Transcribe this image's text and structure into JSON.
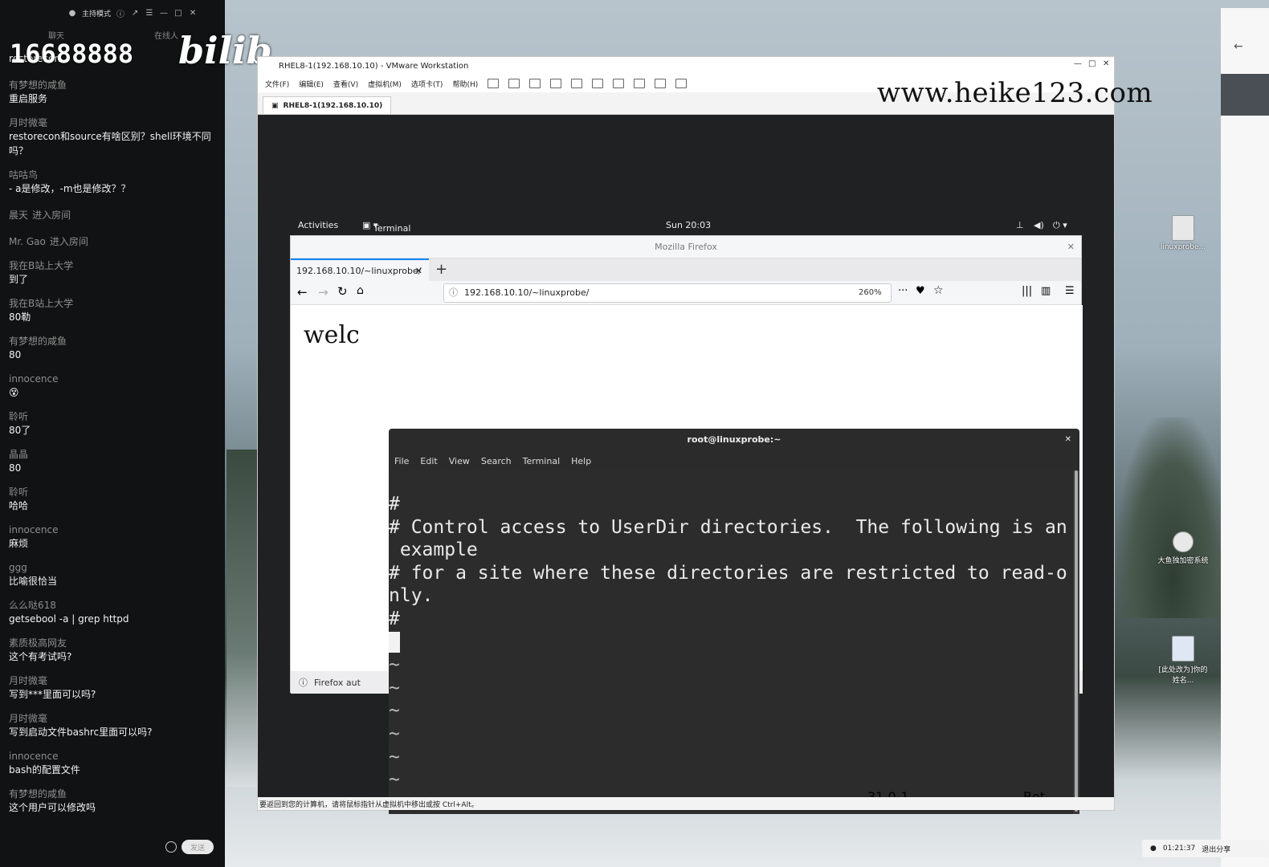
{
  "chat": {
    "topbar_mode": "主持模式",
    "tab_left": "聊天",
    "tab_right": "在线人",
    "overlay_number": "16688888",
    "overlay_logo": "bilibili",
    "first_message": "restorecon",
    "messages": [
      {
        "user": "有梦想的咸鱼",
        "text": "重启服务"
      },
      {
        "user": "月时微毫",
        "text": "restorecon和source有啥区别？shell环境不同吗？"
      },
      {
        "user": "咕咕鸟",
        "text": " - a是修改，-m也是修改？？"
      },
      {
        "user": "晨天",
        "text": "进入房间",
        "join": true
      },
      {
        "user": "Mr. Gao",
        "text": "进入房间",
        "join": true
      },
      {
        "user": "我在B站上大学",
        "text": "到了"
      },
      {
        "user": "我在B站上大学",
        "text": "80勒"
      },
      {
        "user": "有梦想的咸鱼",
        "text": "80"
      },
      {
        "user": "innocence",
        "text": "😵"
      },
      {
        "user": "聆听",
        "text": "80了"
      },
      {
        "user": "晶晶",
        "text": "80"
      },
      {
        "user": "聆听",
        "text": "哈哈"
      },
      {
        "user": "innocence",
        "text": "麻烦"
      },
      {
        "user": "ggg",
        "text": "比喻很恰当"
      },
      {
        "user": "么么哒618",
        "text": "getsebool -a | grep httpd"
      },
      {
        "user": "素质极高网友",
        "text": "这个有考试吗?"
      },
      {
        "user": "月时微毫",
        "text": "写到***里面可以吗?"
      },
      {
        "user": "月时微毫",
        "text": "写到启动文件bashrc里面可以吗?"
      },
      {
        "user": "innocence",
        "text": "bash的配置文件"
      },
      {
        "user": "有梦想的咸鱼",
        "text": "这个用户可以修改吗"
      }
    ],
    "send_label": "发送"
  },
  "watermark": "www.heike123.com",
  "vmware": {
    "title": "RHEL8-1(192.168.10.10) - VMware Workstation",
    "menus": [
      "文件(F)",
      "编辑(E)",
      "查看(V)",
      "虚拟机(M)",
      "选项卡(T)",
      "帮助(H)"
    ],
    "tab_label": "RHEL8-1(192.168.10.10)",
    "status_text": "要返回到您的计算机，请将鼠标指针从虚拟机中移出或按 Ctrl+Alt。"
  },
  "gnome": {
    "activities": "Activities",
    "app_menu": "Terminal",
    "clock": "Sun 20:03"
  },
  "firefox": {
    "window_title": "Mozilla Firefox",
    "tab_title": "192.168.10.10/~linuxprobe/",
    "url": "192.168.10.10/~linuxprobe/",
    "zoom": "260%",
    "page_text": "welc",
    "notification": "Firefox aut"
  },
  "terminal": {
    "title": "root@linuxprobe:~",
    "menus": [
      "File",
      "Edit",
      "View",
      "Search",
      "Terminal",
      "Help"
    ],
    "lines": [
      "#",
      "# Control access to UserDir directories.  The following is an",
      " example",
      "# for a site where these directories are restricted to read-o",
      "nly.",
      "#"
    ],
    "tildes": [
      "~",
      "~",
      "~",
      "~",
      "~",
      "~"
    ],
    "position": "31,0-1",
    "scroll_pos": "Bot"
  },
  "desktop": {
    "icons": [
      {
        "label": "linuxprobe..."
      },
      {
        "label": "大鱼独加密系统"
      },
      {
        "label": "[此处改为]你的姓名..."
      }
    ]
  },
  "tray": {
    "timer": "01:21:37",
    "share": "退出分享"
  }
}
